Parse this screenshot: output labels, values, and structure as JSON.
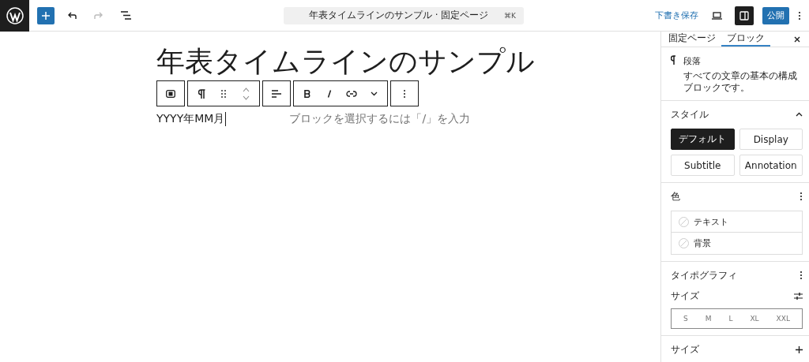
{
  "topbar": {
    "document_title": "年表タイムラインのサンプル · 固定ページ",
    "shortcut": "⌘K",
    "undo_disabled": false,
    "redo_disabled": true,
    "save_draft": "下書き保存",
    "settings_open": true,
    "publish": "公開"
  },
  "editor": {
    "title": "年表タイムラインのサンプル",
    "paragraph": "YYYY年MM月",
    "empty_block_hint": "ブロックを選択するには「/」を入力"
  },
  "sidebar": {
    "tabs": [
      {
        "label": "固定ページ",
        "selected": false
      },
      {
        "label": "ブロック",
        "selected": true
      }
    ],
    "block": {
      "name": "段落",
      "description": "すべての文章の基本の構成ブロックです。"
    },
    "styles": {
      "title": "スタイル",
      "expanded": true,
      "options": [
        {
          "label": "デフォルト",
          "selected": true
        },
        {
          "label": "Display",
          "selected": false
        },
        {
          "label": "Subtitle",
          "selected": false
        },
        {
          "label": "Annotation",
          "selected": false
        }
      ]
    },
    "color": {
      "title": "色",
      "items": [
        "テキスト",
        "背景"
      ]
    },
    "typography": {
      "title": "タイポグラフィ",
      "size_label": "サイズ",
      "sizes": [
        {
          "label": "S",
          "selected": false
        },
        {
          "label": "M",
          "selected": false
        },
        {
          "label": "L",
          "selected": false
        },
        {
          "label": "XL",
          "selected": false
        },
        {
          "label": "XXL",
          "selected": false
        }
      ]
    },
    "dimensions": {
      "title": "サイズ"
    }
  }
}
